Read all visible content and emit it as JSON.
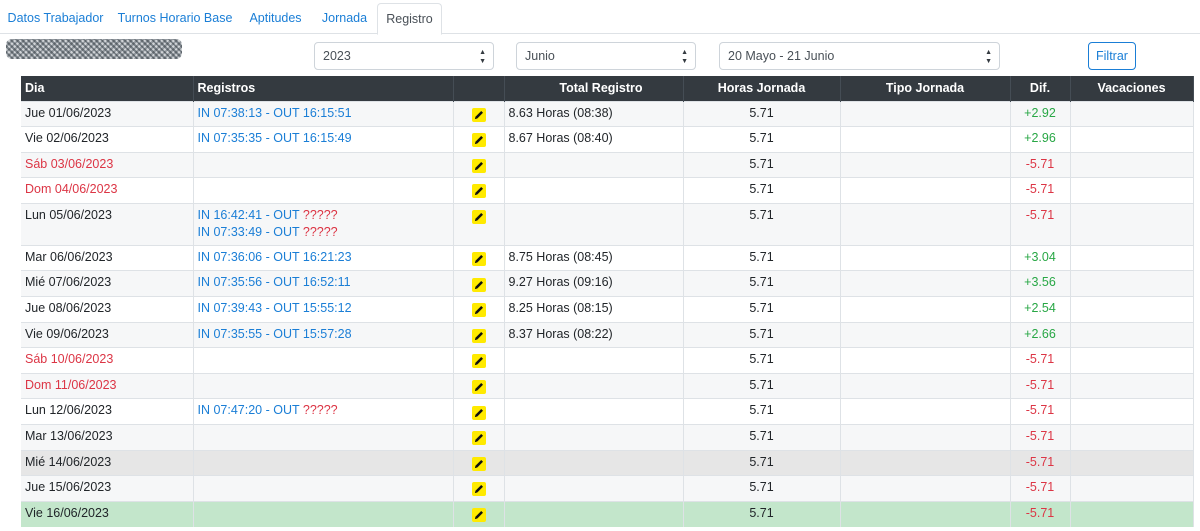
{
  "tabs": [
    {
      "label": "Datos Trabajador"
    },
    {
      "label": "Turnos Horario Base"
    },
    {
      "label": "Aptitudes"
    },
    {
      "label": "Jornada"
    },
    {
      "label": "Registro"
    }
  ],
  "filters": {
    "year": "2023",
    "month": "Junio",
    "period": "20 Mayo - 21 Junio",
    "filter_button": "Filtrar"
  },
  "table": {
    "headers": {
      "dia": "Dia",
      "registros": "Registros",
      "total": "Total Registro",
      "horas": "Horas Jornada",
      "tipo": "Tipo Jornada",
      "dif": "Dif.",
      "vacaciones": "Vacaciones"
    },
    "rows": [
      {
        "dia": "Jue 01/06/2023",
        "reg1_in": "IN 07:38:13 - OUT 16:15:51",
        "reg1_q": "",
        "reg2_in": "",
        "reg2_q": "",
        "total": "8.63 Horas (08:38)",
        "horas": "5.71",
        "tipo": "",
        "dif": "+2.92",
        "vac": ""
      },
      {
        "dia": "Vie 02/06/2023",
        "reg1_in": "IN 07:35:35 - OUT 16:15:49",
        "reg1_q": "",
        "reg2_in": "",
        "reg2_q": "",
        "total": "8.67 Horas (08:40)",
        "horas": "5.71",
        "tipo": "",
        "dif": "+2.96",
        "vac": ""
      },
      {
        "dia": "Sáb 03/06/2023",
        "reg1_in": "",
        "reg1_q": "",
        "reg2_in": "",
        "reg2_q": "",
        "total": "",
        "horas": "5.71",
        "tipo": "",
        "dif": "-5.71",
        "vac": ""
      },
      {
        "dia": "Dom 04/06/2023",
        "reg1_in": "",
        "reg1_q": "",
        "reg2_in": "",
        "reg2_q": "",
        "total": "",
        "horas": "5.71",
        "tipo": "",
        "dif": "-5.71",
        "vac": ""
      },
      {
        "dia": "Lun 05/06/2023",
        "reg1_in": "IN 16:42:41 - OUT ",
        "reg1_q": "?????",
        "reg2_in": "IN 07:33:49 - OUT ",
        "reg2_q": "?????",
        "total": "",
        "horas": "5.71",
        "tipo": "",
        "dif": "-5.71",
        "vac": ""
      },
      {
        "dia": "Mar 06/06/2023",
        "reg1_in": "IN 07:36:06 - OUT 16:21:23",
        "reg1_q": "",
        "reg2_in": "",
        "reg2_q": "",
        "total": "8.75 Horas (08:45)",
        "horas": "5.71",
        "tipo": "",
        "dif": "+3.04",
        "vac": ""
      },
      {
        "dia": "Mié 07/06/2023",
        "reg1_in": "IN 07:35:56 - OUT 16:52:11",
        "reg1_q": "",
        "reg2_in": "",
        "reg2_q": "",
        "total": "9.27 Horas (09:16)",
        "horas": "5.71",
        "tipo": "",
        "dif": "+3.56",
        "vac": ""
      },
      {
        "dia": "Jue 08/06/2023",
        "reg1_in": "IN 07:39:43 - OUT 15:55:12",
        "reg1_q": "",
        "reg2_in": "",
        "reg2_q": "",
        "total": "8.25 Horas (08:15)",
        "horas": "5.71",
        "tipo": "",
        "dif": "+2.54",
        "vac": ""
      },
      {
        "dia": "Vie 09/06/2023",
        "reg1_in": "IN 07:35:55 - OUT 15:57:28",
        "reg1_q": "",
        "reg2_in": "",
        "reg2_q": "",
        "total": "8.37 Horas (08:22)",
        "horas": "5.71",
        "tipo": "",
        "dif": "+2.66",
        "vac": ""
      },
      {
        "dia": "Sáb 10/06/2023",
        "reg1_in": "",
        "reg1_q": "",
        "reg2_in": "",
        "reg2_q": "",
        "total": "",
        "horas": "5.71",
        "tipo": "",
        "dif": "-5.71",
        "vac": ""
      },
      {
        "dia": "Dom 11/06/2023",
        "reg1_in": "",
        "reg1_q": "",
        "reg2_in": "",
        "reg2_q": "",
        "total": "",
        "horas": "5.71",
        "tipo": "",
        "dif": "-5.71",
        "vac": ""
      },
      {
        "dia": "Lun 12/06/2023",
        "reg1_in": "IN 07:47:20 - OUT ",
        "reg1_q": "?????",
        "reg2_in": "",
        "reg2_q": "",
        "total": "",
        "horas": "5.71",
        "tipo": "",
        "dif": "-5.71",
        "vac": ""
      },
      {
        "dia": "Mar 13/06/2023",
        "reg1_in": "",
        "reg1_q": "",
        "reg2_in": "",
        "reg2_q": "",
        "total": "",
        "horas": "5.71",
        "tipo": "",
        "dif": "-5.71",
        "vac": ""
      },
      {
        "dia": "Mié 14/06/2023",
        "reg1_in": "",
        "reg1_q": "",
        "reg2_in": "",
        "reg2_q": "",
        "total": "",
        "horas": "5.71",
        "tipo": "",
        "dif": "-5.71",
        "vac": ""
      },
      {
        "dia": "Jue 15/06/2023",
        "reg1_in": "",
        "reg1_q": "",
        "reg2_in": "",
        "reg2_q": "",
        "total": "",
        "horas": "5.71",
        "tipo": "",
        "dif": "-5.71",
        "vac": ""
      },
      {
        "dia": "Vie 16/06/2023",
        "reg1_in": "",
        "reg1_q": "",
        "reg2_in": "",
        "reg2_q": "",
        "total": "",
        "horas": "5.71",
        "tipo": "",
        "dif": "-5.71",
        "vac": ""
      }
    ]
  },
  "icons": {
    "edit": "pencil-edit-icon",
    "select_arrows": "sort-arrows-icon"
  },
  "colors": {
    "link": "#1a7ed6",
    "negative": "#dc3545",
    "positive": "#28a745",
    "header_bg": "#343a40",
    "highlight_green": "#c3e6cb",
    "highlight_gray": "#e6e6e6",
    "edit_button": "#ffea00"
  }
}
